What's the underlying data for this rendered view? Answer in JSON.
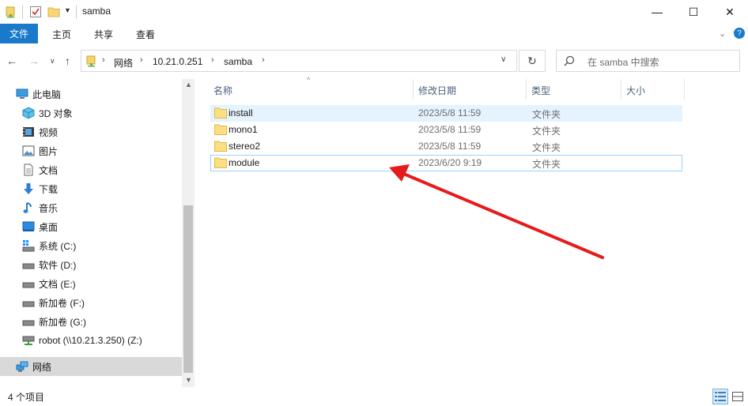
{
  "window": {
    "title": "samba",
    "minimize_glyph": "—",
    "maximize_glyph": "☐",
    "close_glyph": "✕"
  },
  "ribbon": {
    "tabs": [
      "文件",
      "主页",
      "共享",
      "查看"
    ],
    "active_tab_color": "#1979ca"
  },
  "address": {
    "breadcrumbs": [
      "网络",
      "10.21.0.251",
      "samba"
    ],
    "search_placeholder": "在 samba 中搜索"
  },
  "nav": {
    "items": [
      {
        "label": "此电脑",
        "icon": "computer-icon",
        "level": 0
      },
      {
        "label": "3D 对象",
        "icon": "3d-objects-icon",
        "level": 1
      },
      {
        "label": "视频",
        "icon": "video-icon",
        "level": 1
      },
      {
        "label": "图片",
        "icon": "pictures-icon",
        "level": 1
      },
      {
        "label": "文档",
        "icon": "documents-icon",
        "level": 1
      },
      {
        "label": "下载",
        "icon": "download-icon",
        "level": 1
      },
      {
        "label": "音乐",
        "icon": "music-icon",
        "level": 1
      },
      {
        "label": "桌面",
        "icon": "desktop-icon",
        "level": 1
      },
      {
        "label": "系统 (C:)",
        "icon": "system-drive-icon",
        "level": 1
      },
      {
        "label": "软件 (D:)",
        "icon": "drive-icon",
        "level": 1
      },
      {
        "label": "文档 (E:)",
        "icon": "drive-icon",
        "level": 1
      },
      {
        "label": "新加卷 (F:)",
        "icon": "drive-icon",
        "level": 1
      },
      {
        "label": "新加卷 (G:)",
        "icon": "drive-icon",
        "level": 1
      },
      {
        "label": "robot (\\\\10.21.3.250) (Z:)",
        "icon": "network-drive-icon",
        "level": 1
      },
      {
        "label": "网络",
        "icon": "network-icon",
        "level": 0
      }
    ]
  },
  "files": {
    "columns": [
      "名称",
      "修改日期",
      "类型",
      "大小"
    ],
    "rows": [
      {
        "name": "install",
        "date": "2023/5/8 11:59",
        "type": "文件夹"
      },
      {
        "name": "mono1",
        "date": "2023/5/8 11:59",
        "type": "文件夹"
      },
      {
        "name": "stereo2",
        "date": "2023/5/8 11:59",
        "type": "文件夹"
      },
      {
        "name": "module",
        "date": "2023/6/20 9:19",
        "type": "文件夹"
      }
    ]
  },
  "status": {
    "item_count": "4 个项目"
  },
  "annotation": {
    "arrow_color": "#e8191a"
  }
}
